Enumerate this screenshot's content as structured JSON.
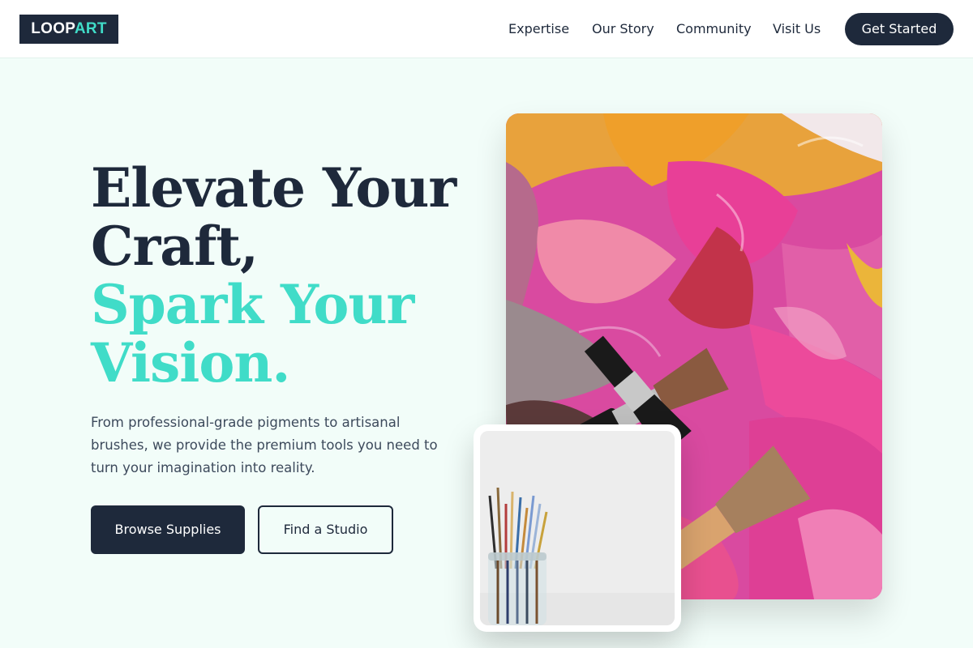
{
  "brand": {
    "part1": "LOOP",
    "part2": "ART"
  },
  "nav": {
    "links": [
      "Expertise",
      "Our Story",
      "Community",
      "Visit Us"
    ],
    "cta": "Get Started"
  },
  "hero": {
    "line1": "Elevate Your",
    "line2": "Craft,",
    "line3": "Spark Your",
    "line4": "Vision.",
    "description": "From professional-grade pigments to artisanal brushes, we provide the premium tools you need to turn your imagination into reality.",
    "primary_button": "Browse Supplies",
    "secondary_button": "Find a Studio"
  },
  "colors": {
    "navy": "#1e293b",
    "teal": "#40dcc8",
    "background": "#f2fdf9"
  },
  "images": {
    "main": "paint-and-brushes-photo",
    "inset": "brushes-in-jar-photo"
  }
}
